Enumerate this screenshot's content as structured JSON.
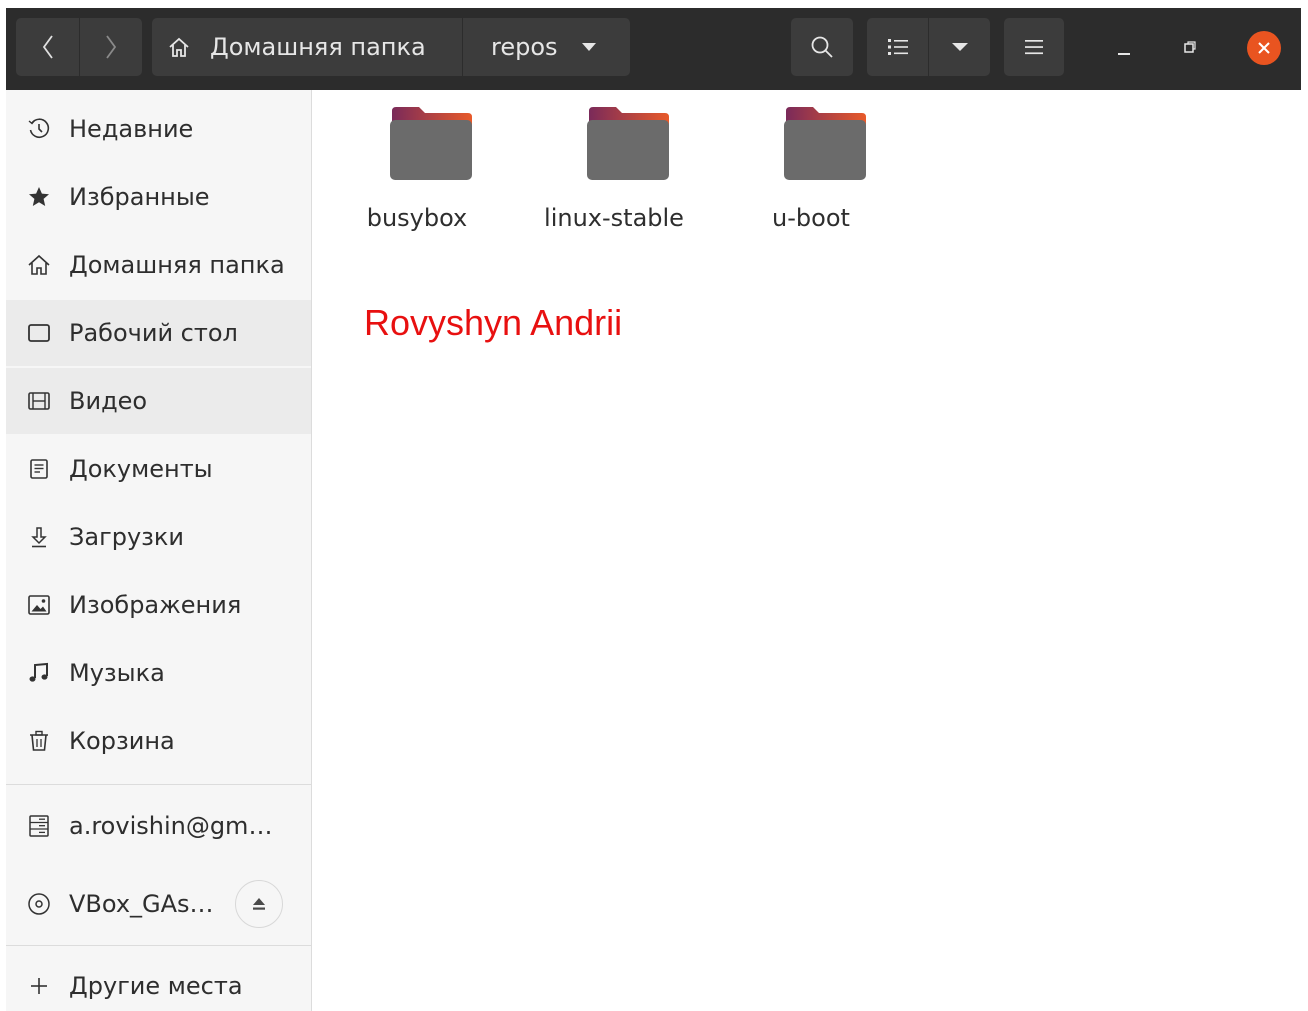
{
  "header": {
    "path": [
      {
        "label": "Домашняя папка"
      },
      {
        "label": "repos"
      }
    ]
  },
  "sidebar": {
    "items": [
      {
        "label": "Недавние",
        "icon": "clock-icon"
      },
      {
        "label": "Избранные",
        "icon": "star-icon"
      },
      {
        "label": "Домашняя папка",
        "icon": "home-icon"
      },
      {
        "label": "Рабочий стол",
        "icon": "desktop-icon"
      },
      {
        "label": "Видео",
        "icon": "film-icon"
      },
      {
        "label": "Документы",
        "icon": "document-icon"
      },
      {
        "label": "Загрузки",
        "icon": "download-icon"
      },
      {
        "label": "Изображения",
        "icon": "image-icon"
      },
      {
        "label": "Музыка",
        "icon": "music-icon"
      },
      {
        "label": "Корзина",
        "icon": "trash-icon"
      }
    ],
    "devices": [
      {
        "label": "a.rovishin@gm…",
        "icon": "network-drive-icon"
      },
      {
        "label": "VBox_GAs…",
        "icon": "disc-icon"
      }
    ],
    "other_places": {
      "label": "Другие места",
      "icon": "plus-icon"
    }
  },
  "content": {
    "folders": [
      {
        "name": "busybox"
      },
      {
        "name": "linux-stable"
      },
      {
        "name": "u-boot"
      }
    ],
    "overlay_text": "Rovyshyn Andrii"
  },
  "colors": {
    "headerbar": "#2c2c2c",
    "button": "#3c3c3c",
    "accent": "#e95420",
    "overlay_text": "#e81010",
    "sidebar": "#f6f6f6"
  }
}
